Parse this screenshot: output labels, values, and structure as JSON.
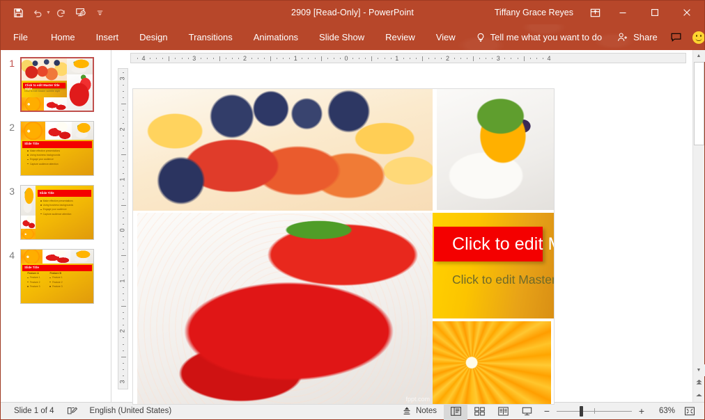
{
  "window": {
    "title": "2909 [Read-Only]  -  PowerPoint",
    "user_name": "Tiffany Grace Reyes",
    "accent_color": "#b7472a"
  },
  "quick_access": {
    "save": "Save",
    "undo": "Undo",
    "redo": "Redo",
    "start_presentation": "Start From Beginning",
    "customize": "Customize Quick Access Toolbar"
  },
  "window_controls": {
    "ribbon_display_options": "Ribbon Display Options",
    "minimize": "Minimize",
    "restore": "Restore Down",
    "close": "Close"
  },
  "ribbon": {
    "tabs": [
      {
        "label": "File"
      },
      {
        "label": "Home"
      },
      {
        "label": "Insert"
      },
      {
        "label": "Design"
      },
      {
        "label": "Transitions"
      },
      {
        "label": "Animations"
      },
      {
        "label": "Slide Show"
      },
      {
        "label": "Review"
      },
      {
        "label": "View"
      }
    ],
    "tell_me": "Tell me what you want to do",
    "share": "Share",
    "comments": "Comments",
    "feedback": "Send a Smile"
  },
  "rulers": {
    "horizontal": [
      "4",
      "3",
      "2",
      "1",
      "0",
      "1",
      "2",
      "3",
      "4"
    ],
    "vertical": [
      "3",
      "2",
      "1",
      "0",
      "1",
      "2",
      "3"
    ]
  },
  "thumbnails": [
    {
      "number": "1",
      "selected": true,
      "layout": "title",
      "title": "Click to edit Master title style",
      "subtitle": "Click to edit Master subtitle style"
    },
    {
      "number": "2",
      "selected": false,
      "layout": "bullets",
      "title": "Slide Title",
      "bullets": [
        "Make effective presentations",
        "Using business backgrounds",
        "Engage your audience",
        "Capture audience attention"
      ]
    },
    {
      "number": "3",
      "selected": false,
      "layout": "bullets-right",
      "title": "Slide Title",
      "bullets": [
        "Make effective presentations",
        "Using business backgrounds",
        "Engage your audience",
        "Capture audience attention"
      ]
    },
    {
      "number": "4",
      "selected": false,
      "layout": "two-column",
      "title": "Slide Title",
      "columns": [
        {
          "heading": "Feature A",
          "items": [
            "Feature 1",
            "Feature 2",
            "Feature 3"
          ]
        },
        {
          "heading": "Feature B",
          "items": [
            "Feature 1",
            "Feature 2",
            "Feature 3"
          ]
        }
      ]
    }
  ],
  "slide": {
    "title_placeholder": "Click to edit Master title style",
    "subtitle_placeholder": "Click to edit Master subtitle style",
    "watermark": "fppt.com",
    "title_banner_color": "#f40000",
    "background_gradient_start": "#ffd200",
    "background_gradient_end": "#d98f14",
    "photos": [
      {
        "name": "fruit-salad-plums-blueberries"
      },
      {
        "name": "mango-dessert-cake"
      },
      {
        "name": "big-strawberry"
      },
      {
        "name": "orange-slice"
      },
      {
        "name": "strawberries-with-cream"
      }
    ]
  },
  "status_bar": {
    "slide_counter": "Slide 1 of 4",
    "language": "English (United States)",
    "notes": "Notes",
    "views": [
      {
        "name": "normal-view",
        "active": true
      },
      {
        "name": "slide-sorter-view",
        "active": false
      },
      {
        "name": "reading-view",
        "active": false
      },
      {
        "name": "slideshow-view",
        "active": false
      }
    ],
    "zoom_out": "−",
    "zoom_in": "+",
    "zoom_level": "63%",
    "fit_to_window": "Fit slide to current window"
  }
}
